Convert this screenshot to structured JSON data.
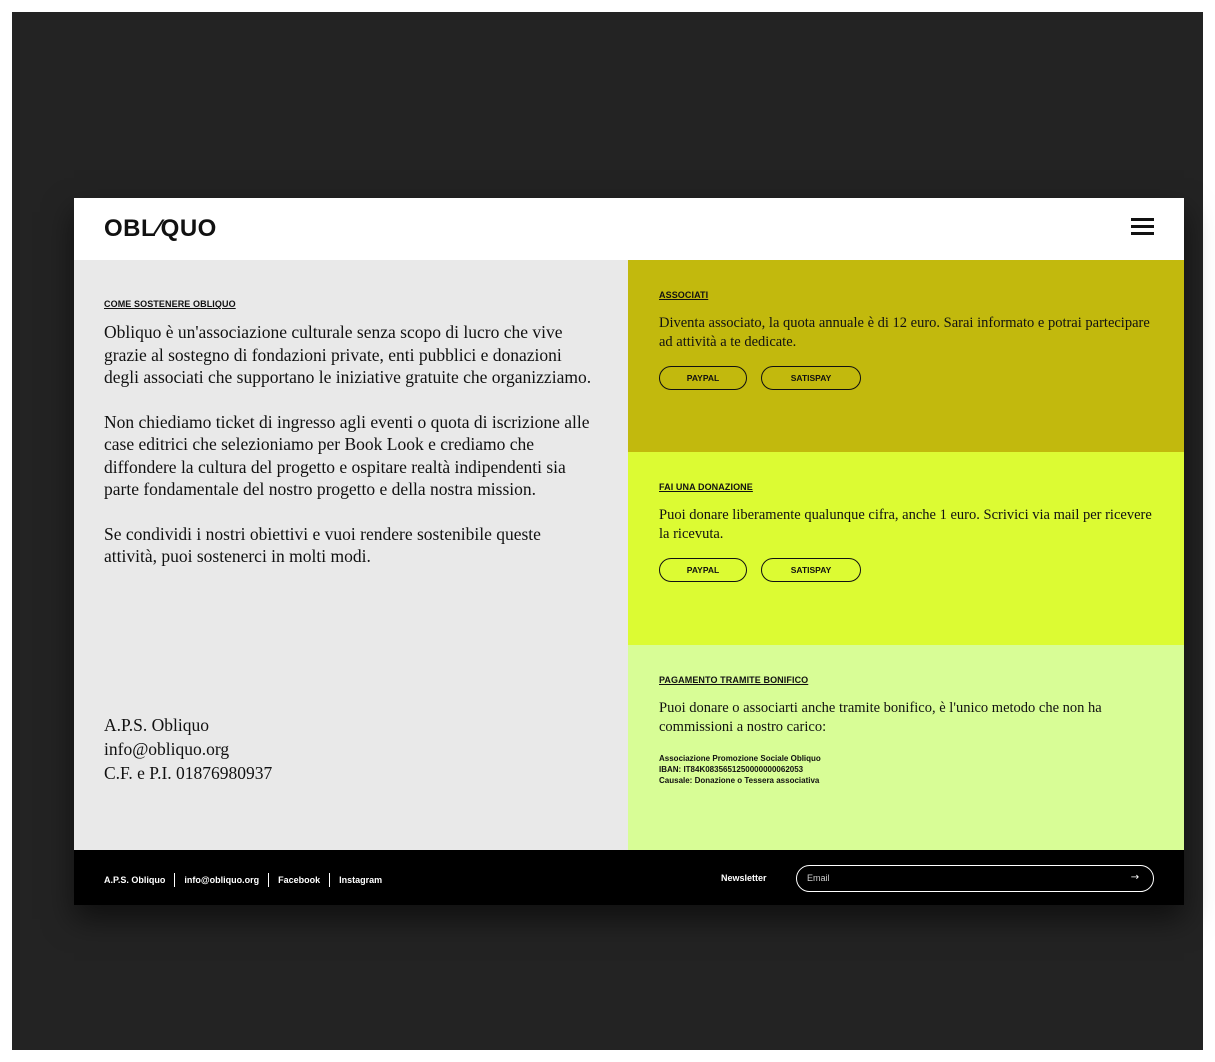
{
  "header": {
    "logo": "OBL⁄QUO",
    "menu_icon": "hamburger-menu-icon"
  },
  "intro": {
    "kicker": "COME SOSTENERE OBLIQUO",
    "paragraphs": [
      "Obliquo è un'associazione culturale senza scopo di lucro che vive grazie al sostegno di fondazioni private, enti pubblici e donazioni degli associati che supportano le iniziative gratuite che organizziamo.",
      "Non chiediamo ticket di ingresso agli eventi o quota di iscrizione alle case editrici che selezioniamo per Book Look e crediamo che diffondere la cultura del progetto e ospitare realtà indipendenti sia parte fondamentale del nostro progetto e della nostra mission.",
      "Se condividi i nostri obiettivi e vuoi rendere sostenibile queste attività, puoi sostenerci in molti modi."
    ],
    "address": {
      "name": "A.P.S. Obliquo",
      "email": "info@obliquo.org",
      "tax": "C.F. e P.I. 01876980937"
    }
  },
  "panels": {
    "associati": {
      "kicker": "ASSOCIATI",
      "text": "Diventa associato, la quota annuale è di 12 euro. Sarai informato e potrai partecipare ad attività a te dedicate.",
      "paypal": "PAYPAL",
      "satispay": "SATISPAY",
      "color": "#c2b90d"
    },
    "donazione": {
      "kicker": "FAI UNA DONAZIONE",
      "text": "Puoi donare liberamente qualunque cifra, anche 1 euro. Scrivici via mail per ricevere la ricevuta.",
      "paypal": "PAYPAL",
      "satispay": "SATISPAY",
      "color": "#dcfb33"
    },
    "bonifico": {
      "kicker": "PAGAMENTO TRAMITE BONIFICO",
      "text": "Puoi donare o associarti anche tramite bonifico, è l'unico metodo che non ha commissioni a nostro carico:",
      "holder": "Associazione Promozione Sociale Obliquo",
      "iban": "IBAN: IT84K0835651250000000062053",
      "causale": "Causale: Donazione o Tessera associativa",
      "color": "#d8fd96"
    }
  },
  "footer": {
    "links": [
      "A.P.S. Obliquo",
      "info@obliquo.org",
      "Facebook",
      "Instagram"
    ],
    "newsletter_label": "Newsletter",
    "email_placeholder": "Email",
    "submit_icon": "arrow-right-icon",
    "submit_glyph": "→"
  }
}
